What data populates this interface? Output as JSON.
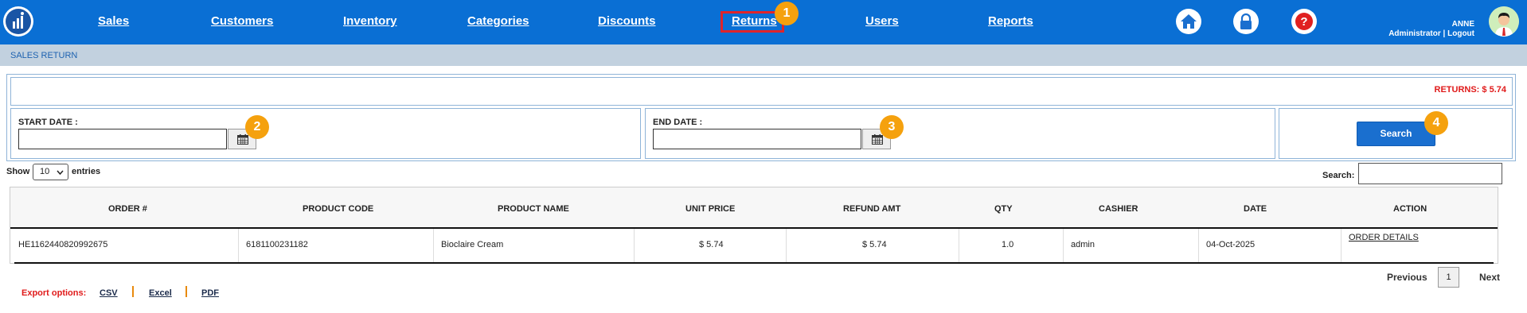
{
  "nav": {
    "items": [
      {
        "label": "Sales"
      },
      {
        "label": "Customers"
      },
      {
        "label": "Inventory"
      },
      {
        "label": "Categories"
      },
      {
        "label": "Discounts"
      },
      {
        "label": "Returns"
      },
      {
        "label": "Users"
      },
      {
        "label": "Reports"
      }
    ],
    "icons": [
      "home-icon",
      "lock-icon",
      "help-icon"
    ]
  },
  "user": {
    "name": "ANNE",
    "role": "Administrator",
    "logout": "Logout",
    "separator": "|"
  },
  "page": {
    "title": "SALES RETURN"
  },
  "filters": {
    "returns_total": "RETURNS: $ 5.74",
    "start_date_label": "START DATE :",
    "start_date_value": "",
    "end_date_label": "END DATE :",
    "end_date_value": "",
    "search_button": "Search"
  },
  "badges": [
    "1",
    "2",
    "3",
    "4"
  ],
  "table_controls": {
    "show_label": "Show",
    "entries_value": "10",
    "entries_label": "entries",
    "search_label": "Search:",
    "search_value": ""
  },
  "table": {
    "headers": [
      "ORDER #",
      "PRODUCT CODE",
      "PRODUCT NAME",
      "UNIT PRICE",
      "REFUND AMT",
      "QTY",
      "CASHIER",
      "DATE",
      "ACTION"
    ],
    "rows": [
      {
        "order": "HE1162440820992675",
        "product_code": "6181100231182",
        "product_name": "Bioclaire Cream",
        "unit_price": "$ 5.74",
        "refund_amt": "$ 5.74",
        "qty": "1.0",
        "cashier": "admin",
        "date": "04-Oct-2025",
        "action": "ORDER DETAILS"
      }
    ]
  },
  "export": {
    "label": "Export options:",
    "options": [
      "CSV",
      "Excel",
      "PDF"
    ]
  },
  "pagination": {
    "previous": "Previous",
    "current": "1",
    "next": "Next"
  },
  "colors": {
    "nav_bg": "#0a6fd4",
    "subheader_bg": "#c2d1df",
    "accent_red": "#e01a1a",
    "badge": "#f5a10e",
    "button": "#1a6fcf"
  }
}
